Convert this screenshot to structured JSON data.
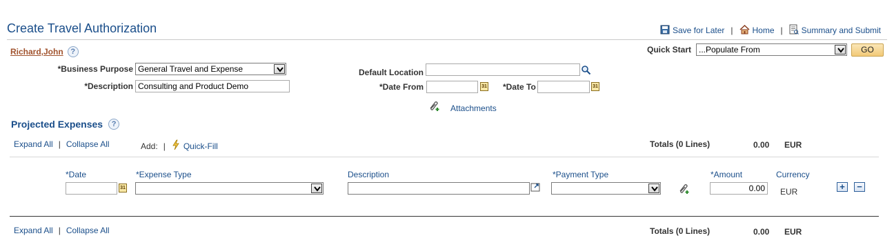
{
  "page_title": "Create Travel Authorization",
  "top_links": {
    "save_for_later": "Save for Later",
    "home": "Home",
    "summary_and_submit": "Summary and Submit",
    "separator": "|"
  },
  "user": {
    "name": "Richard,John",
    "help": "?"
  },
  "quick_start": {
    "label": "Quick Start",
    "value": "...Populate From",
    "go_label": "GO"
  },
  "header_form": {
    "business_purpose_label": "*Business Purpose",
    "business_purpose_value": "General Travel and Expense",
    "description_label": "*Description",
    "description_value": "Consulting and Product Demo",
    "default_location_label": "Default Location",
    "default_location_value": "",
    "date_from_label": "*Date From",
    "date_from_value": "",
    "date_to_label": "*Date To",
    "date_to_value": "",
    "attachments_label": "Attachments"
  },
  "projected_expenses": {
    "title": "Projected Expenses",
    "help": "?",
    "expand_all": "Expand All",
    "collapse_all": "Collapse All",
    "separator": "|",
    "add_label": "Add:",
    "quick_fill": "Quick-Fill",
    "totals_label": "Totals (0 Lines)",
    "totals_amount": "0.00",
    "totals_currency": "EUR",
    "columns": {
      "date": "*Date",
      "expense_type": "*Expense Type",
      "description": "Description",
      "payment_type": "*Payment Type",
      "amount": "*Amount",
      "currency": "Currency"
    },
    "row": {
      "date": "",
      "expense_type": "",
      "description": "",
      "payment_type": "",
      "amount": "0.00",
      "currency": "EUR",
      "add_row": "+",
      "delete_row": "−"
    }
  },
  "icons": {
    "calendar": "calendar-icon",
    "search": "magnifier-icon",
    "attach": "paperclip-icon",
    "quick_fill": "lightning-icon",
    "save": "floppy-icon",
    "home": "house-icon",
    "summary": "document-icon",
    "expand_text": "expand-window-icon"
  },
  "colors": {
    "title": "#1a4e8a",
    "link": "#1a4e8a",
    "user_link": "#a0522d",
    "go_button": "#f6d48a"
  }
}
